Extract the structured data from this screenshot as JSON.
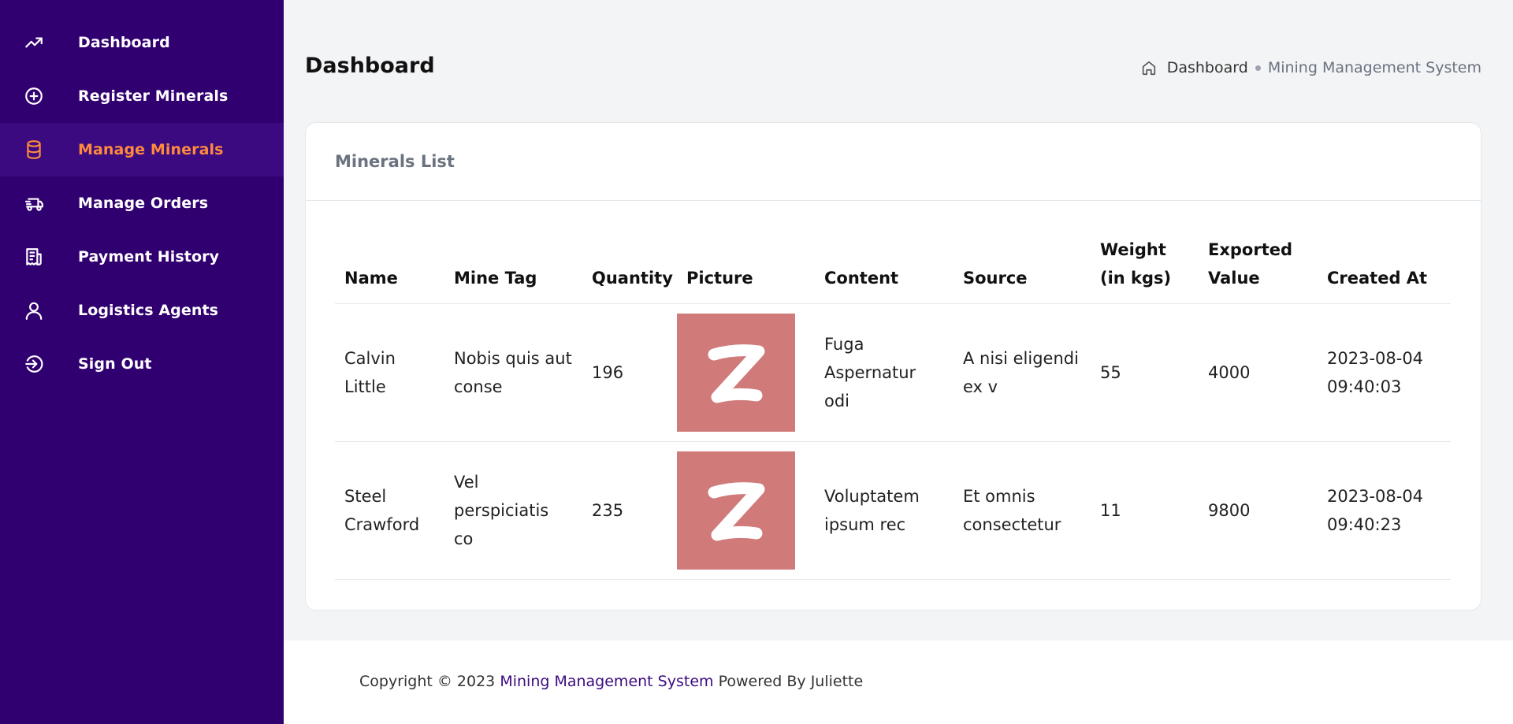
{
  "sidebar": {
    "items": [
      {
        "label": "Dashboard",
        "icon": "trending-up-icon",
        "active": false
      },
      {
        "label": "Register Minerals",
        "icon": "plus-circle-icon",
        "active": false
      },
      {
        "label": "Manage Minerals",
        "icon": "database-icon",
        "active": true
      },
      {
        "label": "Manage Orders",
        "icon": "truck-icon",
        "active": false
      },
      {
        "label": "Payment History",
        "icon": "receipt-icon",
        "active": false
      },
      {
        "label": "Logistics Agents",
        "icon": "user-icon",
        "active": false
      },
      {
        "label": "Sign Out",
        "icon": "sign-out-icon",
        "active": false
      }
    ]
  },
  "header": {
    "title": "Dashboard",
    "breadcrumb": [
      "Dashboard",
      "Mining Management System"
    ]
  },
  "card": {
    "title": "Minerals List"
  },
  "table": {
    "headers": [
      "Name",
      "Mine Tag",
      "Quantity",
      "Picture",
      "Content",
      "Source",
      "Weight (in kgs)",
      "Exported Value",
      "Created At"
    ],
    "rows": [
      {
        "name": "Calvin Little",
        "mine_tag": "Nobis quis aut conse",
        "quantity": "196",
        "picture_letter": "Z",
        "content": "Fuga Aspernatur odi",
        "source": "A nisi eligendi ex v",
        "weight": "55",
        "exported_value": "4000",
        "created_at": "2023-08-04 09:40:03"
      },
      {
        "name": "Steel Crawford",
        "mine_tag": "Vel perspiciatis co",
        "quantity": "235",
        "picture_letter": "Z",
        "content": "Voluptatem ipsum rec",
        "source": "Et omnis consectetur",
        "weight": "11",
        "exported_value": "9800",
        "created_at": "2023-08-04 09:40:23"
      }
    ]
  },
  "footer": {
    "prefix": "Copyright © 2023",
    "brand": "Mining Management System",
    "suffix": "Powered By Juliette"
  },
  "colors": {
    "sidebar_bg": "#310070",
    "active_accent": "#ff8a3d",
    "thumb_bg": "#d07a7a",
    "brand_link": "#3b0a80"
  }
}
